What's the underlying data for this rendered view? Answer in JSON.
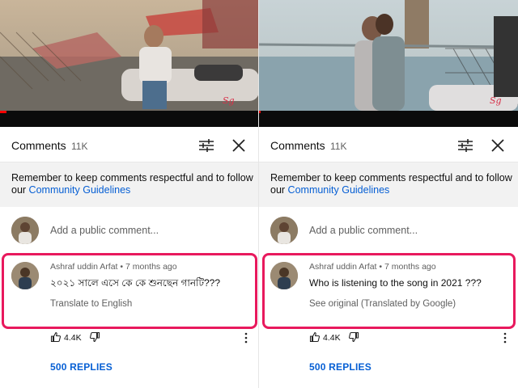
{
  "left": {
    "header": {
      "title": "Comments",
      "count": "11K"
    },
    "notice": {
      "text": "Remember to keep comments respectful and to follow our ",
      "link": "Community Guidelines"
    },
    "add_comment": {
      "placeholder": "Add a public comment..."
    },
    "comment": {
      "author": "Ashraf uddin Arfat",
      "time": "7 months ago",
      "text": "২০২১ সালে এসে কে কে শুনছেন গানটি???",
      "translate_label": "Translate to English",
      "likes": "4.4K",
      "replies_label": "500 REPLIES"
    }
  },
  "right": {
    "header": {
      "title": "Comments",
      "count": "11K"
    },
    "notice": {
      "text": "Remember to keep comments respectful and to follow our ",
      "link": "Community Guidelines"
    },
    "add_comment": {
      "placeholder": "Add a public comment..."
    },
    "comment": {
      "author": "Ashraf uddin Arfat",
      "time": "7 months ago",
      "text": "Who is listening to the song in 2021 ???",
      "translate_label": "See original (Translated by Google)",
      "likes": "4.4K",
      "replies_label": "500 REPLIES"
    }
  },
  "meta_separator": " • ",
  "colors": {
    "link": "#065fd4",
    "highlight": "#e8195d",
    "progress": "#ff0000"
  },
  "icons": [
    "filter-icon",
    "close-icon",
    "like-icon",
    "dislike-icon",
    "more-vertical-icon"
  ]
}
